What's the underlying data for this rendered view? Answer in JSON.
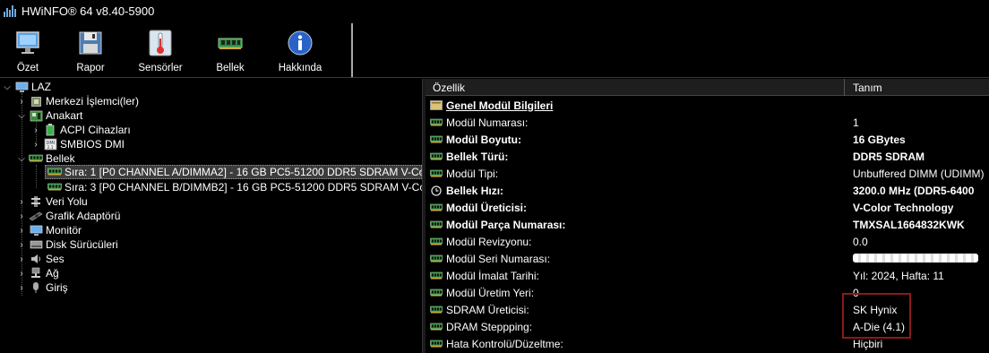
{
  "window": {
    "title": "HWiNFO® 64 v8.40-5900"
  },
  "toolbar": {
    "buttons": [
      {
        "label": "Özet",
        "icon": "monitor-icon"
      },
      {
        "label": "Rapor",
        "icon": "floppy-icon"
      },
      {
        "label": "Sensörler",
        "icon": "thermometer-icon"
      },
      {
        "label": "Bellek",
        "icon": "ram-icon"
      },
      {
        "label": "Hakkında",
        "icon": "info-icon"
      }
    ]
  },
  "tree": {
    "root": "LAZ",
    "items": [
      {
        "label": "Merkezi İşlemci(ler)",
        "icon": "cpu-icon"
      },
      {
        "label": "Anakart",
        "icon": "motherboard-icon"
      },
      {
        "label": "ACPI Cihazları",
        "icon": "battery-icon"
      },
      {
        "label": "SMBIOS DMI",
        "icon": "dmi-icon"
      },
      {
        "label": "Bellek",
        "icon": "ram-icon"
      },
      {
        "label": "Sıra: 1 [P0 CHANNEL A/DIMMA2] - 16 GB PC5-51200 DDR5 SDRAM V-Co",
        "icon": "ram-module-icon"
      },
      {
        "label": "Sıra: 3 [P0 CHANNEL B/DIMMB2] - 16 GB PC5-51200 DDR5 SDRAM V-Co",
        "icon": "ram-module-icon"
      },
      {
        "label": "Veri Yolu",
        "icon": "bus-icon"
      },
      {
        "label": "Grafik Adaptörü",
        "icon": "gpu-icon"
      },
      {
        "label": "Monitör",
        "icon": "monitor-icon"
      },
      {
        "label": "Disk Sürücüleri",
        "icon": "disk-icon"
      },
      {
        "label": "Ses",
        "icon": "speaker-icon"
      },
      {
        "label": "Ağ",
        "icon": "network-icon"
      },
      {
        "label": "Giriş",
        "icon": "input-icon"
      }
    ]
  },
  "details": {
    "col_property": "Özellik",
    "col_value": "Tanım",
    "rows": [
      {
        "label": "Genel Modül Bilgileri",
        "value": "",
        "style": "section",
        "icon": "section-icon"
      },
      {
        "label": "Modül Numarası:",
        "value": "1",
        "style": "normal",
        "icon": "ram-small-icon"
      },
      {
        "label": "Modül Boyutu:",
        "value": "16 GBytes",
        "style": "bold",
        "icon": "ram-small-icon"
      },
      {
        "label": "Bellek Türü:",
        "value": "DDR5 SDRAM",
        "style": "bold",
        "icon": "ram-small-icon"
      },
      {
        "label": "Modül Tipi:",
        "value": "Unbuffered DIMM (UDIMM)",
        "style": "normal",
        "icon": "ram-small-icon"
      },
      {
        "label": "Bellek Hızı:",
        "value": "3200.0 MHz (DDR5-6400",
        "style": "bold",
        "icon": "clock-icon"
      },
      {
        "label": "Modül Üreticisi:",
        "value": "V-Color Technology",
        "style": "bold",
        "icon": "ram-small-icon"
      },
      {
        "label": "Modül Parça Numarası:",
        "value": "TMXSAL1664832KWK",
        "style": "bold",
        "icon": "ram-small-icon"
      },
      {
        "label": "Modül Revizyonu:",
        "value": "0.0",
        "style": "normal",
        "icon": "ram-small-icon"
      },
      {
        "label": "Modül Seri Numarası:",
        "value": "",
        "style": "redacted",
        "icon": "ram-small-icon"
      },
      {
        "label": "Modül İmalat Tarihi:",
        "value": "Yıl: 2024, Hafta: 11",
        "style": "normal",
        "icon": "ram-small-icon"
      },
      {
        "label": "Modül Üretim Yeri:",
        "value": "0",
        "style": "normal",
        "icon": "ram-small-icon"
      },
      {
        "label": "SDRAM Üreticisi:",
        "value": "SK Hynix",
        "style": "normal",
        "icon": "ram-small-icon"
      },
      {
        "label": "DRAM Steppping:",
        "value": "A-Die (4.1)",
        "style": "normal",
        "icon": "ram-small-icon"
      },
      {
        "label": "Hata Kontrolü/Düzeltme:",
        "value": "Hiçbiri",
        "style": "normal",
        "icon": "ram-small-icon"
      }
    ]
  },
  "colors": {
    "highlight_box": "#8b1a1a",
    "selection": "#3c3c3c"
  }
}
